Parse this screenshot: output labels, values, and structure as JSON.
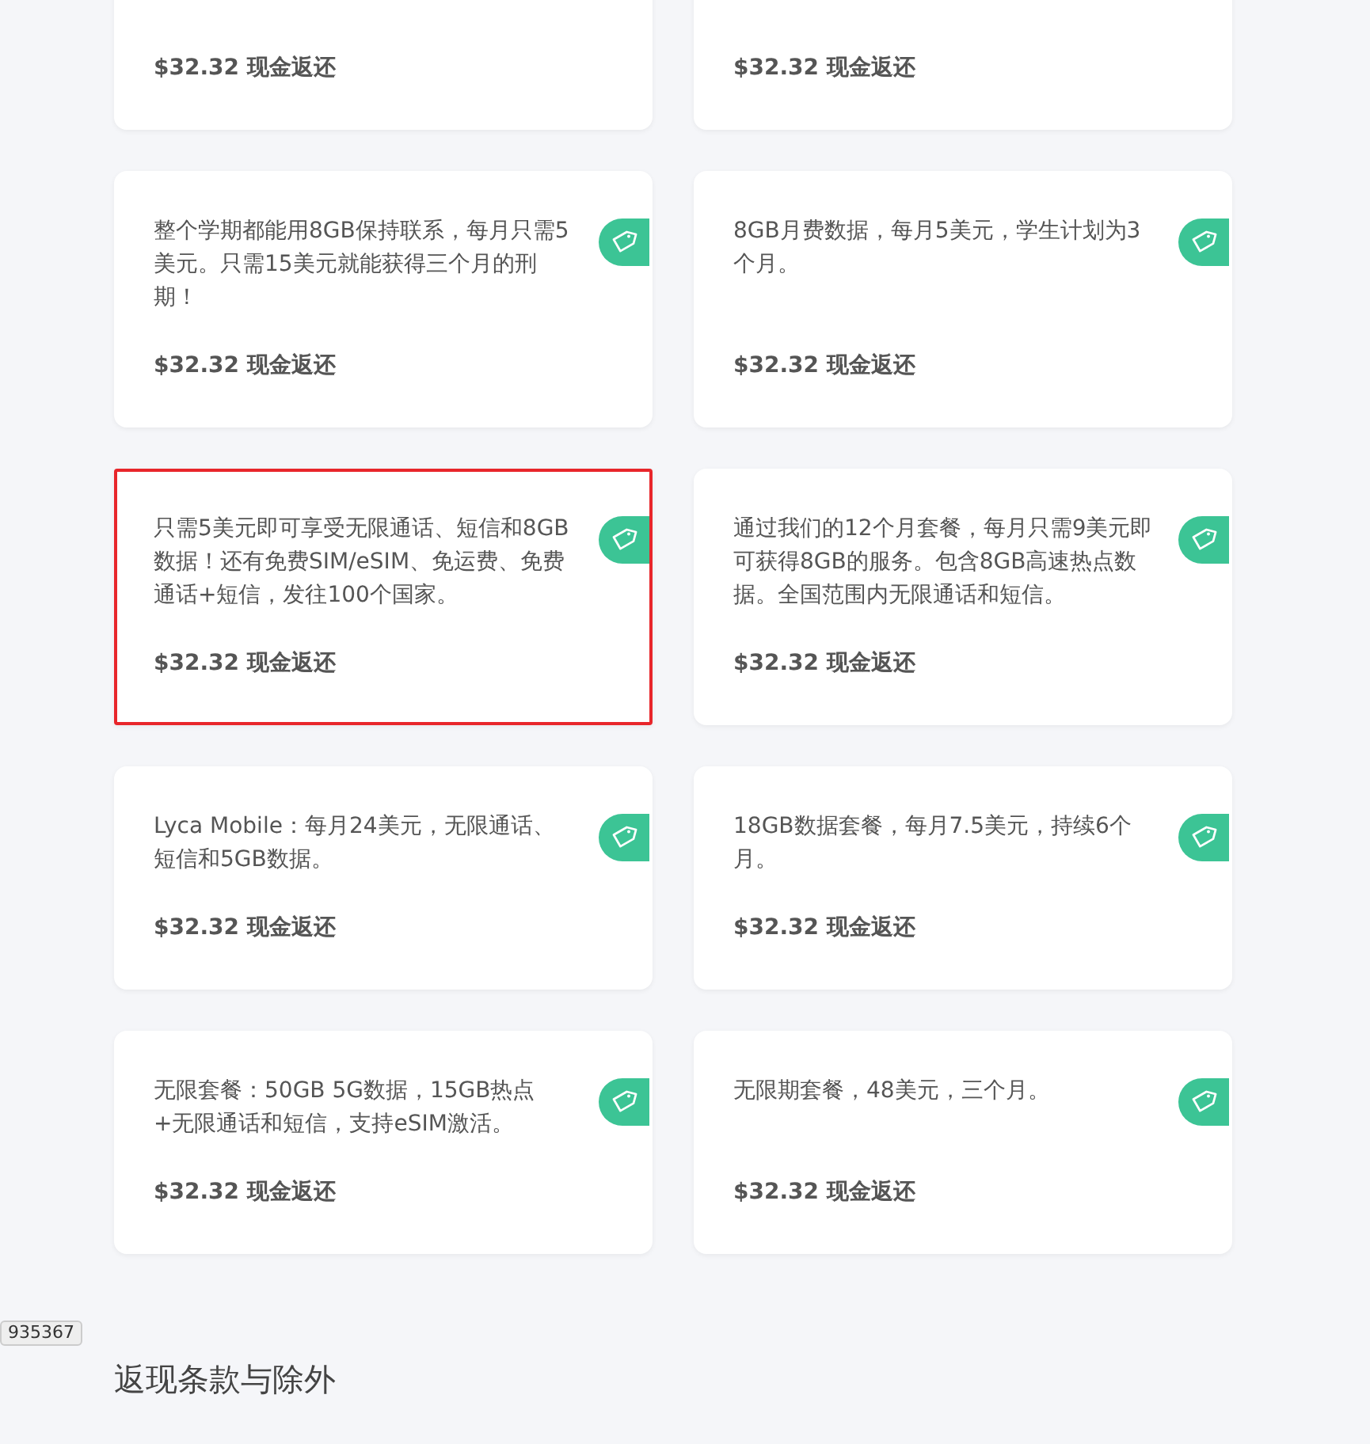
{
  "offers": [
    {
      "cashback": "$32.32 **现金返还**",
      "highlighted": false
    },
    {
      "cashback": "$32.32 **现金返还**",
      "highlighted": false
    },
    {
      "description": "整个学期都能用8GB保持联系，每月只需5美元。只需15美元就能获得三个月的刑期！",
      "cashback": "$32.32 **现金返还**",
      "highlighted": false
    },
    {
      "description": "8GB月费数据，每月5美元，学生计划为3个月。",
      "cashback": "$32.32 **现金返还**",
      "highlighted": false
    },
    {
      "description": "只需5美元即可享受无限通话、短信和8GB数据！还有免费SIM/eSIM、免运费、免费通话+短信，发往100个国家。",
      "cashback": "$32.32 **现金返还**",
      "highlighted": true
    },
    {
      "description": "通过我们的12个月套餐，每月只需9美元即可获得8GB的服务。包含8GB高速热点数据。全国范围内无限通话和短信。",
      "cashback": "$32.32 **现金返还**",
      "highlighted": false
    },
    {
      "description": "Lyca Mobile：每月24美元，无限通话、短信和5GB数据。",
      "cashback": "$32.32 **现金返还**",
      "highlighted": false
    },
    {
      "description": "18GB数据套餐，每月7.5美元，持续6个月。",
      "cashback": "$32.32 **现金返还**",
      "highlighted": false
    },
    {
      "description": "无限套餐：50GB 5G数据，15GB热点+无限通话和短信，支持eSIM激活。",
      "cashback": "$32.32 **现金返还**",
      "highlighted": false
    },
    {
      "description": "无限期套餐，48美元，三个月。",
      "cashback": "$32.32 **现金返还**",
      "highlighted": false
    }
  ],
  "section_title": "返现条款与除外",
  "corner_badge": "935367"
}
